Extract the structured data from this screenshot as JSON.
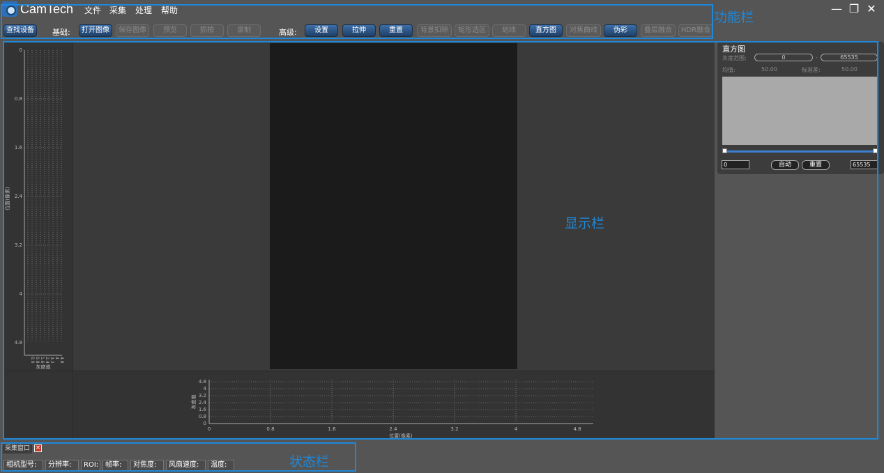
{
  "app": {
    "name": "CamTech"
  },
  "menu": [
    "文件",
    "采集",
    "处理",
    "帮助"
  ],
  "window_controls": {
    "minimize": "—",
    "restore": "❐",
    "close": "✕"
  },
  "toolbar": {
    "find_device": "查找设备",
    "basic_label": "基础:",
    "advanced_label": "高级:",
    "basic_buttons": [
      {
        "label": "打开图像",
        "enabled": true
      },
      {
        "label": "保存图像",
        "enabled": false
      },
      {
        "label": "预览",
        "enabled": false
      },
      {
        "label": "抓拍",
        "enabled": false
      },
      {
        "label": "录制",
        "enabled": false
      }
    ],
    "advanced_buttons": [
      {
        "label": "设置",
        "enabled": true
      },
      {
        "label": "拉伸",
        "enabled": true
      },
      {
        "label": "重置",
        "enabled": true
      },
      {
        "label": "背景扣除",
        "enabled": false
      },
      {
        "label": "矩形选区",
        "enabled": false
      },
      {
        "label": "划线",
        "enabled": false
      },
      {
        "label": "直方图",
        "enabled": true
      },
      {
        "label": "对焦曲线",
        "enabled": false
      },
      {
        "label": "伪彩",
        "enabled": true
      },
      {
        "label": "叠层融合",
        "enabled": false
      },
      {
        "label": "HDR融合",
        "enabled": false
      }
    ]
  },
  "left_profile": {
    "ylabel": "位置(像素)",
    "xlabel": "灰度值",
    "y_ticks": [
      "0",
      "0.8",
      "1.6",
      "2.4",
      "3.2",
      "4",
      "4.8"
    ],
    "x_ticks": [
      "0.0",
      "0.8",
      "1.6",
      "2.4",
      "3.2",
      "4",
      "4.8"
    ]
  },
  "bottom_profile": {
    "ylabel": "灰度值",
    "xlabel": "位置(像素)",
    "y_ticks": [
      "4.8",
      "4",
      "3.2",
      "2.4",
      "1.6",
      "0.8",
      "0"
    ],
    "x_ticks": [
      "0",
      "0.8",
      "1.6",
      "2.4",
      "3.2",
      "4",
      "4.8"
    ]
  },
  "histogram": {
    "title": "直方图",
    "range_label": "灰度范围:",
    "range_min": "0",
    "range_sep": "-",
    "range_max": "65535",
    "mean_label": "均值:",
    "mean_value": "50.00",
    "std_label": "标准差:",
    "std_value": "50.00",
    "low_spin": "0",
    "high_spin": "65535",
    "auto_button": "自动",
    "reset_button": "重置"
  },
  "status": {
    "tab_label": "采集窗口",
    "fields": [
      "相机型号:",
      "分辨率:",
      "ROI:",
      "帧率:",
      "对焦度:",
      "风扇速度:",
      "温度:"
    ]
  },
  "annotations": {
    "function_bar": "功能栏",
    "display_bar": "显示栏",
    "status_bar": "状态栏",
    "color": "#1e88d9"
  }
}
